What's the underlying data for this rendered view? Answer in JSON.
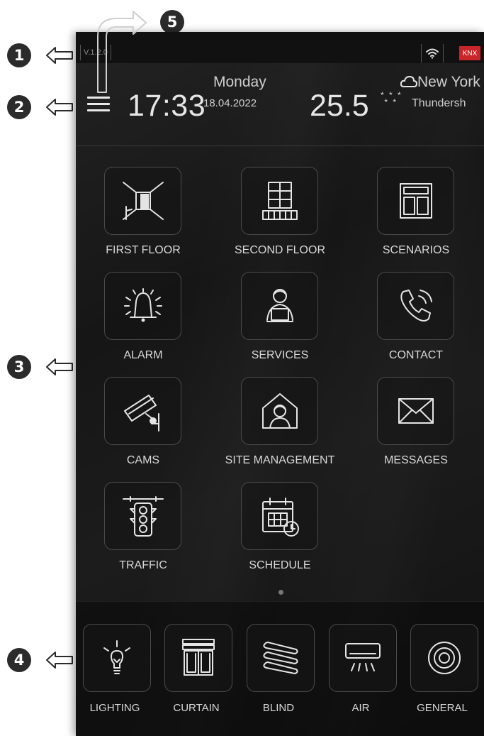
{
  "callouts": [
    "1",
    "2",
    "3",
    "4",
    "5"
  ],
  "status": {
    "version": "V.1.2.0",
    "knx": "KNX"
  },
  "header": {
    "time": "17:33",
    "day": "Monday",
    "date": "18.04.2022",
    "temperature": "25.5",
    "snow_glyph": "* * *\n * *",
    "city": "New York",
    "condition": "Thundersh"
  },
  "tiles": [
    {
      "label": "FIRST FLOOR",
      "icon": "room-door-icon"
    },
    {
      "label": "SECOND FLOOR",
      "icon": "balcony-window-icon"
    },
    {
      "label": "SCENARIOS",
      "icon": "layout-panel-icon"
    },
    {
      "label": "ALARM",
      "icon": "alarm-bell-icon"
    },
    {
      "label": "SERVICES",
      "icon": "person-laptop-icon"
    },
    {
      "label": "CONTACT",
      "icon": "phone-call-icon"
    },
    {
      "label": "CAMS",
      "icon": "security-camera-icon"
    },
    {
      "label": "SITE MANAGEMENT",
      "icon": "house-person-icon"
    },
    {
      "label": "MESSAGES",
      "icon": "envelope-icon"
    },
    {
      "label": "TRAFFIC",
      "icon": "traffic-light-icon"
    },
    {
      "label": "SCHEDULE",
      "icon": "calendar-clock-icon"
    }
  ],
  "dock": [
    {
      "label": "LIGHTING",
      "icon": "light-bulb-icon"
    },
    {
      "label": "CURTAIN",
      "icon": "curtain-icon"
    },
    {
      "label": "BLIND",
      "icon": "blind-icon"
    },
    {
      "label": "AIR",
      "icon": "air-conditioner-icon"
    },
    {
      "label": "GENERAL",
      "icon": "target-circle-icon"
    }
  ],
  "colors": {
    "background": "#181818",
    "knx_badge": "#c9252a",
    "text": "#d8d8d8"
  }
}
